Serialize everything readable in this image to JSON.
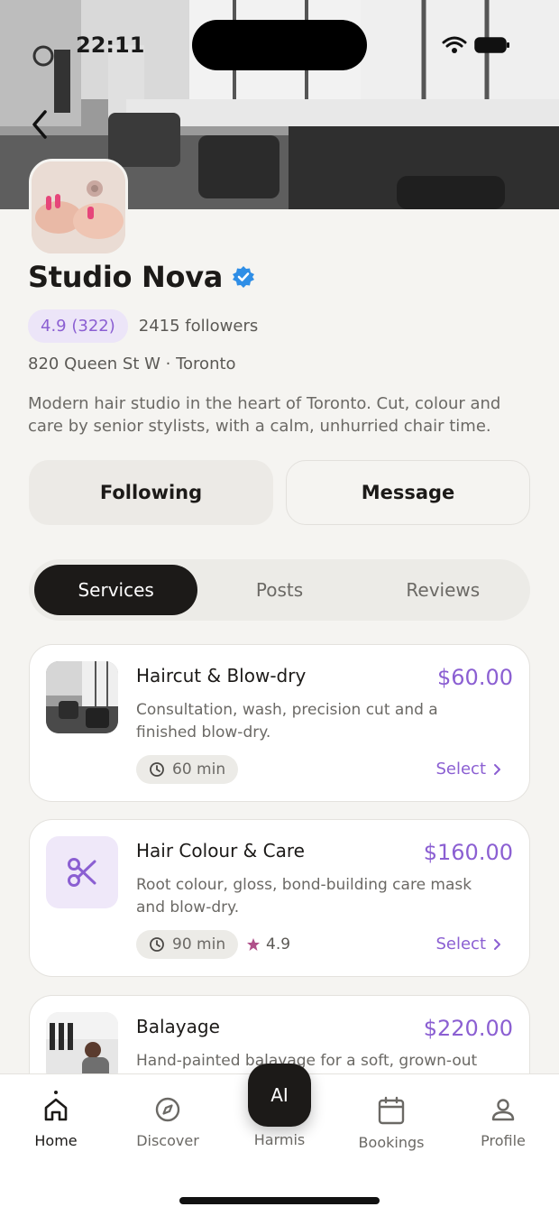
{
  "status_bar": {
    "time": "22:11"
  },
  "profile": {
    "name": "Studio Nova",
    "rating": "4.9 (322)",
    "followers": "2415 followers",
    "address": "820 Queen St W · Toronto",
    "bio": "Modern hair studio in the heart of Toronto. Cut, colour and care by senior stylists, with a calm, unhurried chair time."
  },
  "actions": {
    "following_label": "Following",
    "message_label": "Message"
  },
  "tabs": [
    {
      "label": "Services",
      "active": true
    },
    {
      "label": "Posts",
      "active": false
    },
    {
      "label": "Reviews",
      "active": false
    }
  ],
  "services": [
    {
      "title": "Haircut & Blow-dry",
      "price": "$60.00",
      "description": "Consultation, wash, precision cut and a finished blow-dry.",
      "duration": "60 min",
      "select_label": "Select",
      "icon": "salon-photo"
    },
    {
      "title": "Hair Colour & Care",
      "price": "$160.00",
      "description": "Root colour, gloss, bond-building care mask and blow-dry.",
      "duration": "90 min",
      "rating": "4.9",
      "select_label": "Select",
      "icon": "scissors-icon"
    },
    {
      "title": "Balayage",
      "price": "$220.00",
      "description": "Hand-painted balayage for a soft, grown-out",
      "icon": "stylist-photo"
    }
  ],
  "bottom_nav": {
    "items": [
      {
        "label": "Home",
        "icon": "home-icon",
        "active": true
      },
      {
        "label": "Discover",
        "icon": "compass-icon",
        "active": false
      },
      {
        "label": "Bookings",
        "icon": "calendar-icon",
        "active": false
      },
      {
        "label": "Profile",
        "icon": "user-icon",
        "active": false
      }
    ],
    "ai_button": {
      "label": "AI",
      "caption": "Harmis"
    }
  },
  "colors": {
    "accent": "#8b5fd2",
    "verified": "#2f8ee6",
    "dark": "#1c1a18",
    "star": "#b0508a"
  }
}
